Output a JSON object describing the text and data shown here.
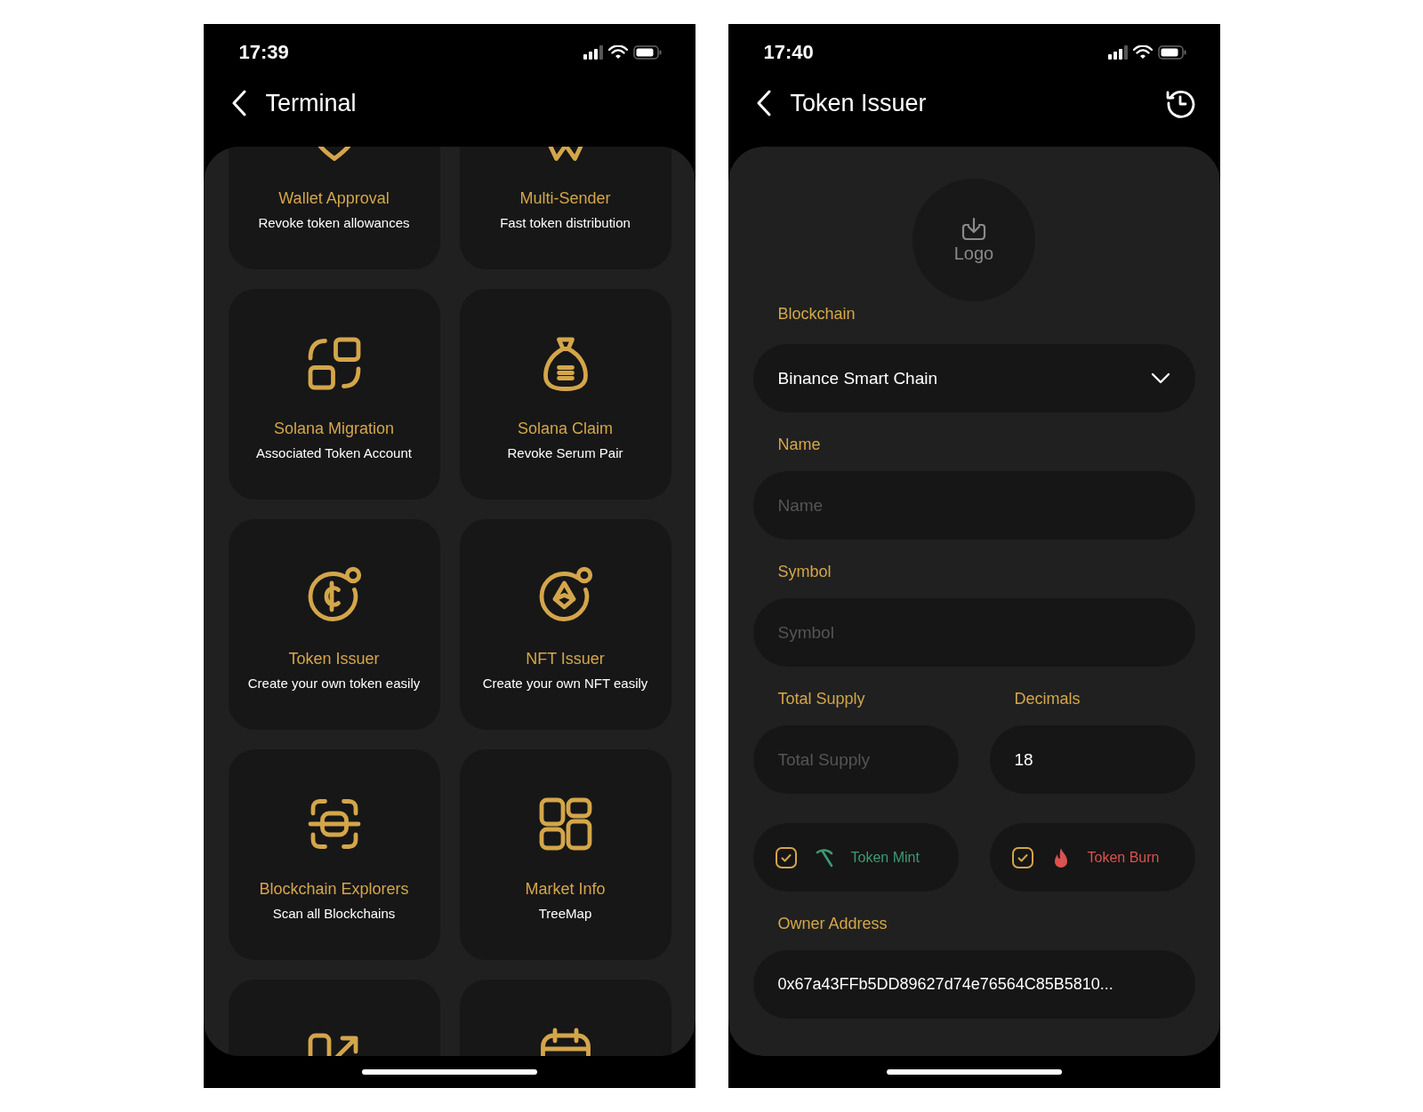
{
  "screens": [
    {
      "kind": "terminal",
      "status_bar": {
        "time": "17:39"
      },
      "header": {
        "title": "Terminal"
      },
      "tools": [
        {
          "kind": "tool",
          "title": "Wallet Approval",
          "subtitle": "Revoke token allowances"
        },
        {
          "kind": "tool",
          "title": "Multi-Sender",
          "subtitle": "Fast token distribution"
        },
        {
          "kind": "tool",
          "title": "Solana Migration",
          "subtitle": "Associated Token Account"
        },
        {
          "kind": "tool",
          "title": "Solana Claim",
          "subtitle": "Revoke Serum Pair"
        },
        {
          "kind": "tool",
          "title": "Token Issuer",
          "subtitle": "Create your own token easily"
        },
        {
          "kind": "tool",
          "title": "NFT Issuer",
          "subtitle": "Create your own NFT easily"
        },
        {
          "kind": "tool",
          "title": "Blockchain Explorers",
          "subtitle": "Scan all Blockchains"
        },
        {
          "kind": "tool",
          "title": "Market Info",
          "subtitle": "TreeMap"
        },
        {
          "kind": "tool"
        },
        {
          "kind": "tool"
        }
      ]
    },
    {
      "kind": "issuer",
      "status_bar": {
        "time": "17:40"
      },
      "header": {
        "title": "Token Issuer"
      },
      "logo_button": {
        "label": "Logo"
      },
      "blockchain": {
        "label": "Blockchain",
        "value": "Binance Smart Chain"
      },
      "name": {
        "label": "Name",
        "placeholder": "Name"
      },
      "symbol": {
        "label": "Symbol",
        "placeholder": "Symbol"
      },
      "total_supply": {
        "label": "Total Supply",
        "placeholder": "Total Supply"
      },
      "decimals": {
        "label": "Decimals",
        "value": "18"
      },
      "options": [
        {
          "kind": "mint",
          "label": "Token Mint",
          "checked": true,
          "color": "#3e9a72"
        },
        {
          "kind": "burn",
          "label": "Token Burn",
          "checked": true,
          "color": "#d9534f"
        }
      ],
      "owner_address": {
        "label": "Owner Address",
        "value": "0x67a43FFb5DD89627d74e76564C85B5810..."
      }
    }
  ]
}
